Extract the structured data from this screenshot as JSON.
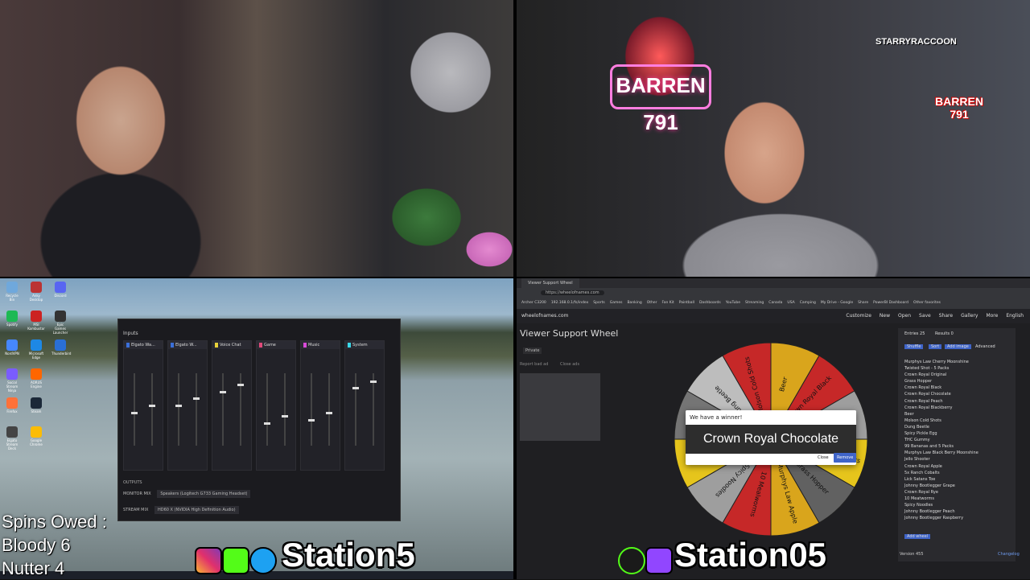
{
  "overlay": {
    "spins_owed_label": "Spins Owed :",
    "spins_line_1": "Bloody 6",
    "spins_line_2": "Nutter 4",
    "left_brand": "Station5",
    "right_brand": "Station05",
    "corner_logo_1": "STARRYRACCOON",
    "corner_logo_2": "BARREN 791",
    "neon_sign": "BARREN 791"
  },
  "obs_mixer": {
    "title": "Inputs",
    "channels": [
      {
        "label": "Elgato Wa...",
        "color": "#3b6fd8",
        "level": 0.45
      },
      {
        "label": "Elgato W...",
        "color": "#3b6fd8",
        "level": 0.55
      },
      {
        "label": "Voice Chat",
        "color": "#e8d23a",
        "level": 0.75
      },
      {
        "label": "Game",
        "color": "#e04a7a",
        "level": 0.3
      },
      {
        "label": "Music",
        "color": "#d84ad8",
        "level": 0.35
      },
      {
        "label": "System",
        "color": "#3ad8e8",
        "level": 0.8
      }
    ],
    "outputs_title": "OUTPUTS",
    "outputs": [
      {
        "label": "MONITOR MIX",
        "device": "Speakers (Logitech G733 Gaming Headset)"
      },
      {
        "label": "STREAM MIX",
        "device": "HD60 X (NVIDIA High Definition Audio)"
      }
    ]
  },
  "desktop_icons": [
    "Recycle Bin",
    "Spotify",
    "NordVPN",
    "Social Stream Ninja",
    "Firefox",
    "Elgato Stream Deck",
    "Anky Desktop",
    "MSI Kombustor",
    "Microsoft Edge",
    "AORUS Engine",
    "Steam",
    "Google Chrome",
    "Discord",
    "Epic Games Launcher",
    "Thunderbird"
  ],
  "browser": {
    "tab_title": "Viewer Support Wheel",
    "url": "https://wheelofnames.com",
    "bookmarks": [
      "Archer C3200",
      "192.168.0.1/fs/index",
      "Sports",
      "Games",
      "Banking",
      "Other",
      "Fan Kit",
      "Paintball",
      "Dashboards",
      "YouTube",
      "Streaming",
      "Canada",
      "USA",
      "Camping",
      "My Drive - Google",
      "Share",
      "PowerBI Dashboard",
      "Other favorites"
    ],
    "site_name": "wheelofnames.com",
    "site_menu": [
      "Customize",
      "New",
      "Open",
      "Save",
      "Share",
      "Gallery",
      "More",
      "English"
    ],
    "wheel_title": "Viewer Support Wheel",
    "private_label": "Private",
    "report_ad": "Report bad ad",
    "close_ads": "Close ads",
    "entries_tab": "Entries",
    "entries_count": "25",
    "results_tab": "Results",
    "results_count": "0",
    "shuffle": "Shuffle",
    "sort": "Sort",
    "add_image": "Add image",
    "advanced": "Advanced",
    "entries": [
      "Murphys Law Cherry Moonshine",
      "Twisted Shot - 5 Packs",
      "Crown Royal Original",
      "Grass Hopper",
      "Crown Royal Black",
      "Crown Royal Chocolate",
      "Crown Royal Peach",
      "Crown Royal Blackberry",
      "Beer",
      "Molson Cold Shots",
      "Dung Beetle",
      "Spicy Pickle Egg",
      "THC Gummy",
      "99 Bananas and 5 Packs",
      "Murphys Law Black Berry Moonshine",
      "Jello Shooter",
      "Crown Royal Apple",
      "5x Ranch Cobalts",
      "Lick Satans Toe",
      "Johnny Bootlegger Grape",
      "Crown Royal Rye",
      "10 Meatworms",
      "Spicy Noodles",
      "Johnny Bootlegger Peach",
      "Johnny Bootlegger Raspberry"
    ],
    "add_wheel": "Add wheel",
    "version": "Version 455",
    "changelog": "Changelog",
    "winner_header": "We have a winner!",
    "winner_name": "Crown Royal Chocolate",
    "close_btn": "Close",
    "remove_btn": "Remove",
    "wheel_segments": [
      "Beer",
      "Crown Royal Black",
      "Crown Royal Peach",
      "Twisted Shot - 5 Packs",
      "Grass Hopper",
      "Murphys Law Apple",
      "10 Mealworms",
      "Spicy Noodles",
      "THC Gummy",
      "Spicy Pickle Egg",
      "Dung Beetle",
      "Molson Cold Shots"
    ],
    "wheel_colors": [
      "#d9a51c",
      "#c62828",
      "#9e9e9e",
      "#e6c51c",
      "#616161",
      "#d9a51c",
      "#c62828",
      "#9e9e9e",
      "#e6c51c",
      "#757575",
      "#bdbdbd",
      "#c62828"
    ]
  }
}
